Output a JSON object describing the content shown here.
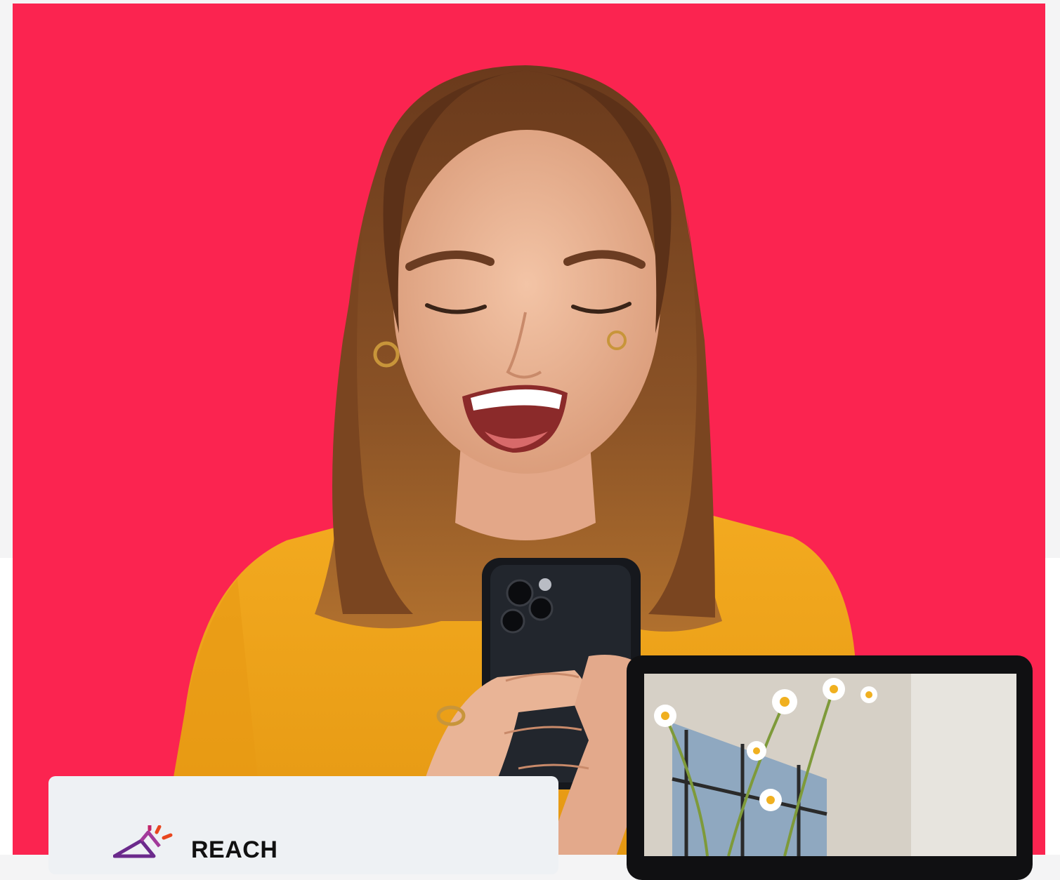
{
  "colors": {
    "hero_background": "#fb2450",
    "card_background": "#eef1f4",
    "shirt": "#f2a81c"
  },
  "hero": {
    "image": "woman-smiling-at-phone-photo"
  },
  "reach_card": {
    "logo_icon": "megaphone-icon",
    "label": "REACH"
  },
  "tablet": {
    "screen_image": "daisies-flower-photo"
  }
}
